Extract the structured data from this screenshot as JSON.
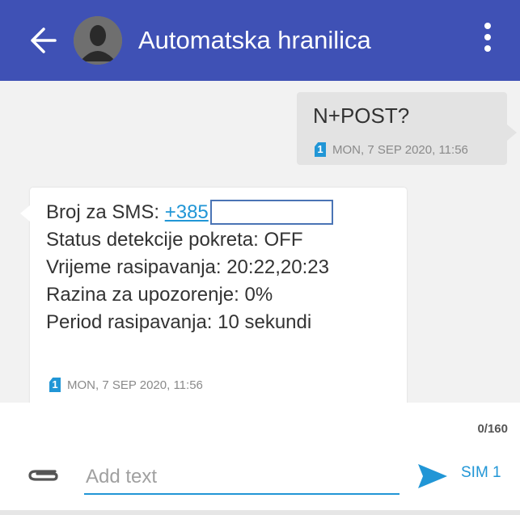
{
  "appbar": {
    "title": "Automatska hranilica",
    "icons": [
      "back-arrow-icon",
      "contact-avatar-icon",
      "more-vert-icon"
    ],
    "color": "#3f51b5"
  },
  "messages": {
    "outgoing": {
      "text": "N+POST?",
      "sim": "1",
      "timestamp": "MON, 7 SEP 2020, 11:56"
    },
    "incoming": {
      "line1_prefix": "Broj za SMS: ",
      "line1_link": "+385",
      "line2": "Status detekcije pokreta: OFF",
      "line3": "Vrijeme rasipavanja: 20:22,20:23",
      "line4": "Razina za upozorenje: 0%",
      "line5": "Period rasipavanja: 10 sekundi",
      "sim": "1",
      "timestamp": "MON, 7 SEP 2020, 11:56"
    }
  },
  "composer": {
    "counter": "0/160",
    "placeholder": "Add text",
    "value": "",
    "sim_label": "SIM 1",
    "accent": "#2196d6"
  }
}
